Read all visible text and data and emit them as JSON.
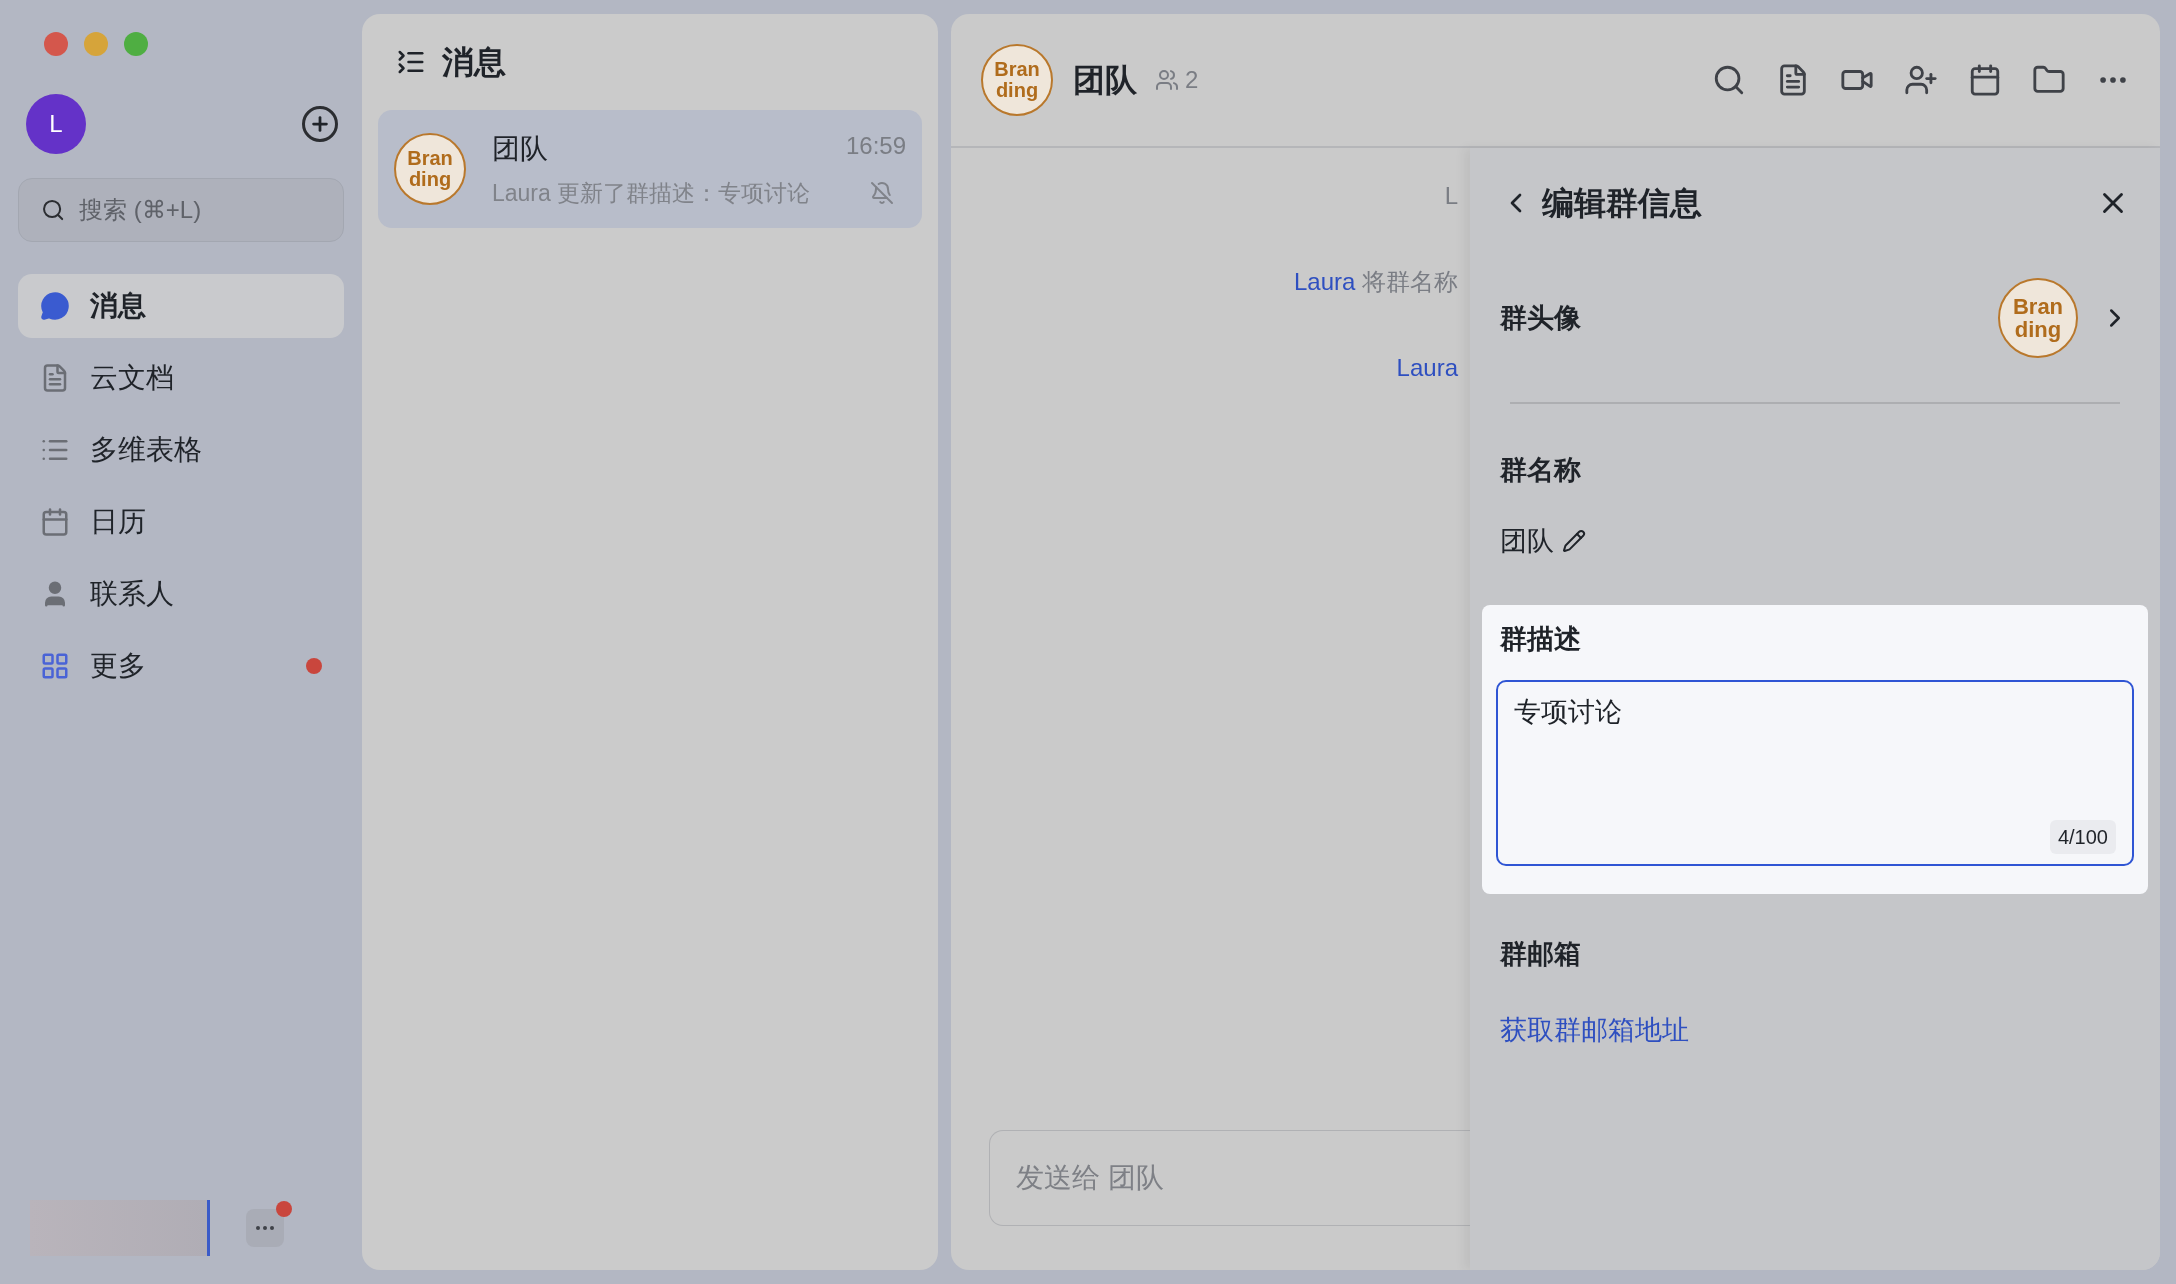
{
  "sidebar": {
    "avatar_letter": "L",
    "search": {
      "placeholder": "搜索 (⌘+L)"
    },
    "items": [
      {
        "label": "消息",
        "selected": true,
        "dot": false
      },
      {
        "label": "云文档",
        "selected": false,
        "dot": false
      },
      {
        "label": "多维表格",
        "selected": false,
        "dot": false
      },
      {
        "label": "日历",
        "selected": false,
        "dot": false
      },
      {
        "label": "联系人",
        "selected": false,
        "dot": false
      },
      {
        "label": "更多",
        "selected": false,
        "dot": true
      }
    ],
    "footer": {
      "more_dot": true
    }
  },
  "chat_list": {
    "title": "消息",
    "items": [
      {
        "avatar": [
          "Bran",
          "ding"
        ],
        "name": "团队",
        "time": "16:59",
        "preview": "Laura 更新了群描述：专项讨论",
        "muted": true,
        "selected": true
      }
    ]
  },
  "chat": {
    "avatar": [
      "Bran",
      "ding"
    ],
    "title": "团队",
    "members": "2",
    "messages": [
      {
        "text": "L"
      },
      {
        "actor": "Laura",
        "text": "将群名称"
      },
      {
        "actor": "Laura"
      }
    ],
    "input": {
      "placeholder": "发送给 团队"
    }
  },
  "edit_panel": {
    "title": "编辑群信息",
    "avatar_label": "群头像",
    "avatar": [
      "Bran",
      "ding"
    ],
    "name_label": "群名称",
    "name": "团队",
    "description_label": "群描述",
    "description": {
      "value": "专项讨论",
      "count": "4/100",
      "focused": true
    },
    "mailbox_label": "群邮箱",
    "mailbox_link": "获取群邮箱地址"
  }
}
